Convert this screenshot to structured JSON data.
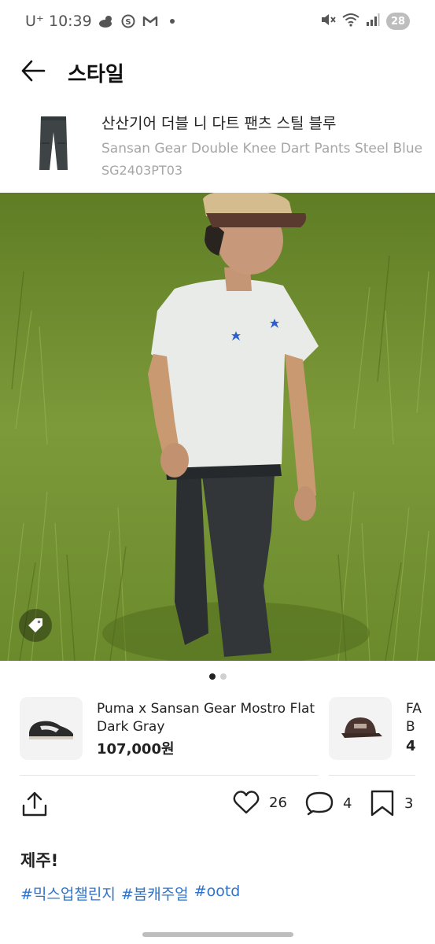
{
  "status_bar": {
    "carrier_time": "U⁺ 10:39",
    "battery": "28",
    "icons": [
      "cloud-sun-icon",
      "shield-icon",
      "gmail-icon",
      "dot-icon",
      "mute-icon",
      "wifi-icon",
      "signal-icon"
    ]
  },
  "header": {
    "title": "스타일",
    "back_icon": "back-arrow-icon"
  },
  "product": {
    "name_kr": "산산기어 더블 니 다트 팬츠 스틸 블루",
    "name_en": "Sansan Gear Double Knee Dart Pants Steel Blue",
    "code": "SG2403PT03"
  },
  "carousel": {
    "count": 2,
    "active_index": 0
  },
  "tagged_products": [
    {
      "name": "Puma x Sansan Gear Mostro Flat Dark Gray",
      "price": "107,000원"
    },
    {
      "name": "FA",
      "name_line2": "B",
      "price": "4"
    }
  ],
  "actions": {
    "likes": "26",
    "comments": "4",
    "bookmarks": "3"
  },
  "caption": "제주!",
  "hashtags": [
    "#믹스업챌린지",
    "#봄캐주얼",
    "#ootd"
  ],
  "colors": {
    "hashtag": "#2f74c8",
    "muted_text": "#a6a6a6",
    "grass": "#6b8a2e"
  }
}
